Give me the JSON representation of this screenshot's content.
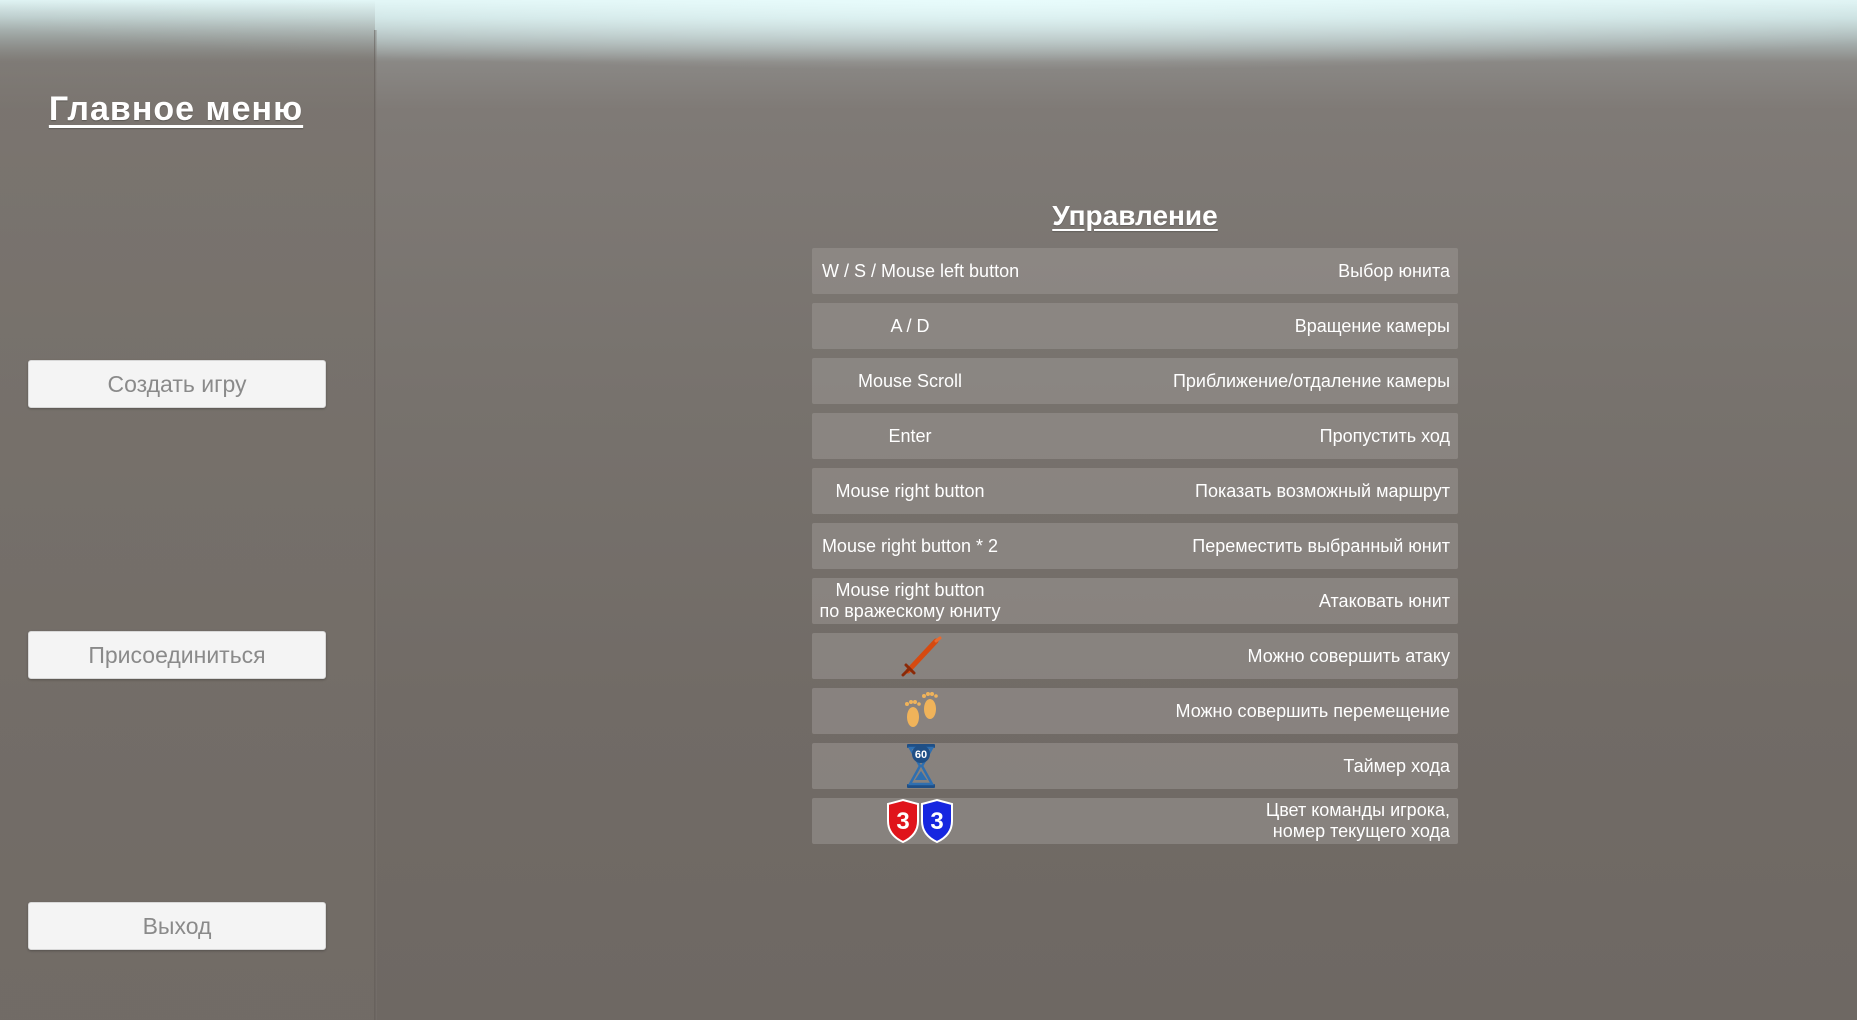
{
  "main_menu": {
    "title": "Главное меню",
    "buttons": {
      "create_game": "Создать игру",
      "join": "Присоединиться",
      "exit": "Выход"
    }
  },
  "controls": {
    "title": "Управление",
    "rows": [
      {
        "key": "W / S / Mouse left button",
        "action": "Выбор юнита"
      },
      {
        "key": "A / D",
        "action": "Вращение камеры"
      },
      {
        "key": "Mouse Scroll",
        "action": "Приближение/отдаление камеры"
      },
      {
        "key": "Enter",
        "action": "Пропустить ход"
      },
      {
        "key": "Mouse right button",
        "action": "Показать возможный маршрут"
      },
      {
        "key": "Mouse right button * 2",
        "action": "Переместить выбранный юнит"
      },
      {
        "key_line1": "Mouse right button",
        "key_line2": "по вражескому юниту",
        "action": "Атаковать юнит"
      },
      {
        "icon": "sword-icon",
        "action": "Можно совершить атаку"
      },
      {
        "icon": "footprints-icon",
        "action": "Можно совершить перемещение"
      },
      {
        "icon": "hourglass-timer-icon",
        "timer_value": "60",
        "action": "Таймер хода"
      },
      {
        "icon": "team-shields-icon",
        "red_shield_number": "3",
        "blue_shield_number": "3",
        "action_line1": "Цвет команды игрока,",
        "action_line2": "номер текущего хода"
      }
    ]
  },
  "colors": {
    "sword": "#d64a10",
    "footprints": "#f0b35a",
    "hourglass": "#2f6fb0",
    "team_red": "#e0141b",
    "team_blue": "#1626e0"
  }
}
